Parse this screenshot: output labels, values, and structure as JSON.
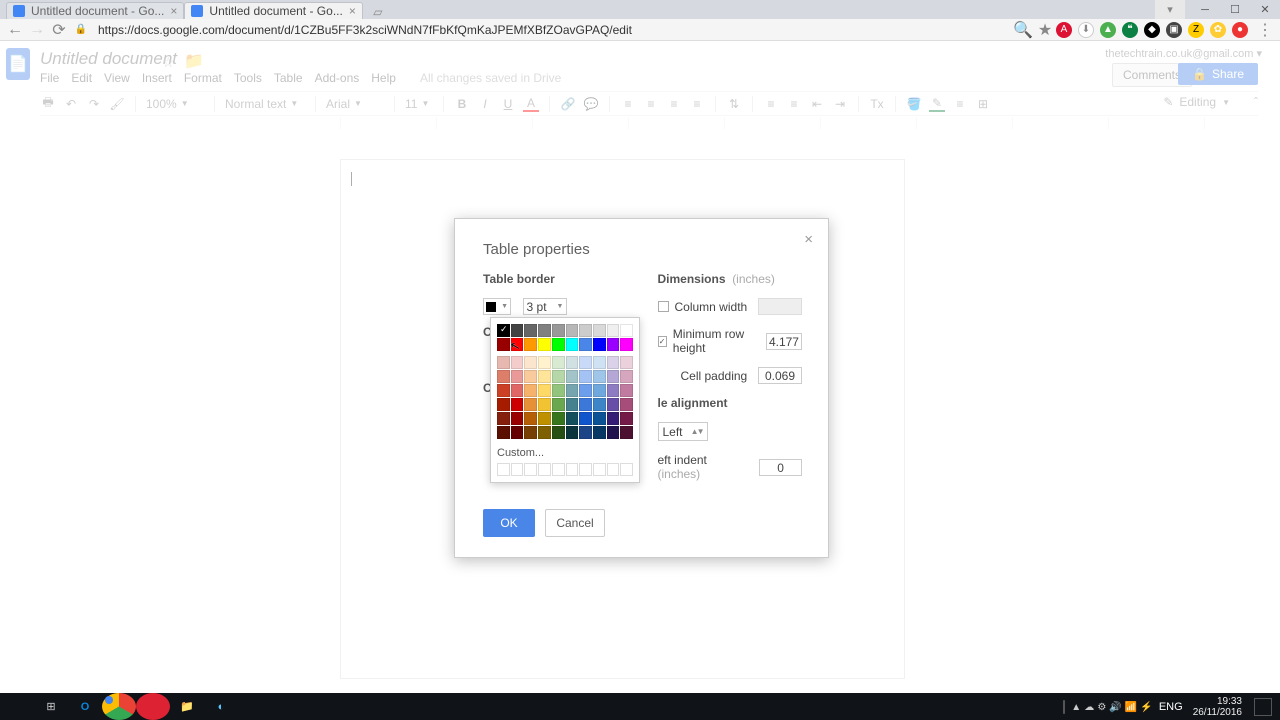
{
  "browser": {
    "tabs": [
      {
        "title": "Untitled document - Go...",
        "active": false
      },
      {
        "title": "Untitled document - Go...",
        "active": true
      }
    ],
    "url": "https://docs.google.com/document/d/1CZBu5FF3k2sciWNdN7fFbKfQmKaJPEMfXBfZOavGPAQ/edit"
  },
  "extensions": [
    "abp",
    "drive",
    "cloud",
    "hang",
    "db",
    "play",
    "z",
    "photo",
    "circ"
  ],
  "docs": {
    "title": "Untitled document",
    "user_email": "thetechtrain.co.uk@gmail.com",
    "menus": [
      "File",
      "Edit",
      "View",
      "Insert",
      "Format",
      "Tools",
      "Table",
      "Add-ons",
      "Help"
    ],
    "save_status": "All changes saved in Drive",
    "comments_label": "Comments",
    "share_label": "Share",
    "toolbar": {
      "zoom": "100%",
      "style": "Normal text",
      "font": "Arial",
      "size": "11",
      "editing": "Editing"
    }
  },
  "dialog": {
    "title": "Table properties",
    "border_h": "Table border",
    "border_width": "3 pt",
    "cellbg_label_initial": "C",
    "cellalign_label_initial": "C",
    "dimensions_h": "Dimensions",
    "dimensions_hint": "(inches)",
    "col_width_label": "Column width",
    "min_row_label": "Minimum row height",
    "min_row_value": "4.177",
    "cell_pad_label": "Cell padding",
    "cell_pad_value": "0.069",
    "table_align_h_partial": "le alignment",
    "table_align_value": "Left",
    "left_indent_label_partial": "eft indent",
    "left_indent_hint": "(inches)",
    "left_indent_value": "0",
    "ok": "OK",
    "cancel": "Cancel"
  },
  "palette": {
    "grays": [
      "#000000",
      "#434343",
      "#666666",
      "#808080",
      "#999999",
      "#b7b7b7",
      "#cccccc",
      "#d9d9d9",
      "#efefef",
      "#ffffff"
    ],
    "mains": [
      "#980000",
      "#ff0000",
      "#ff9900",
      "#ffff00",
      "#00ff00",
      "#00ffff",
      "#4a86e8",
      "#0000ff",
      "#9900ff",
      "#ff00ff"
    ],
    "shades": [
      [
        "#e6b8af",
        "#f4cccc",
        "#fce5cd",
        "#fff2cc",
        "#d9ead3",
        "#d0e0e3",
        "#c9daf8",
        "#cfe2f3",
        "#d9d2e9",
        "#ead1dc"
      ],
      [
        "#dd7e6b",
        "#ea9999",
        "#f9cb9c",
        "#ffe599",
        "#b6d7a8",
        "#a2c4c9",
        "#a4c2f4",
        "#9fc5e8",
        "#b4a7d6",
        "#d5a6bd"
      ],
      [
        "#cc4125",
        "#e06666",
        "#f6b26b",
        "#ffd966",
        "#93c47d",
        "#76a5af",
        "#6d9eeb",
        "#6fa8dc",
        "#8e7cc3",
        "#c27ba0"
      ],
      [
        "#a61c00",
        "#cc0000",
        "#e69138",
        "#f1c232",
        "#6aa84f",
        "#45818e",
        "#3c78d8",
        "#3d85c6",
        "#674ea7",
        "#a64d79"
      ],
      [
        "#85200c",
        "#990000",
        "#b45f06",
        "#bf9000",
        "#38761d",
        "#134f5c",
        "#1155cc",
        "#0b5394",
        "#351c75",
        "#741b47"
      ],
      [
        "#5b0f00",
        "#660000",
        "#783f04",
        "#7f6000",
        "#274e13",
        "#0c343d",
        "#1c4587",
        "#073763",
        "#20124d",
        "#4c1130"
      ]
    ],
    "custom_label": "Custom..."
  },
  "taskbar": {
    "time": "19:33",
    "date": "26/11/2016",
    "lang": "ENG",
    "tray_icons": [
      "▲",
      "☁",
      "⚙",
      "🔊",
      "📶",
      "⚡"
    ]
  }
}
